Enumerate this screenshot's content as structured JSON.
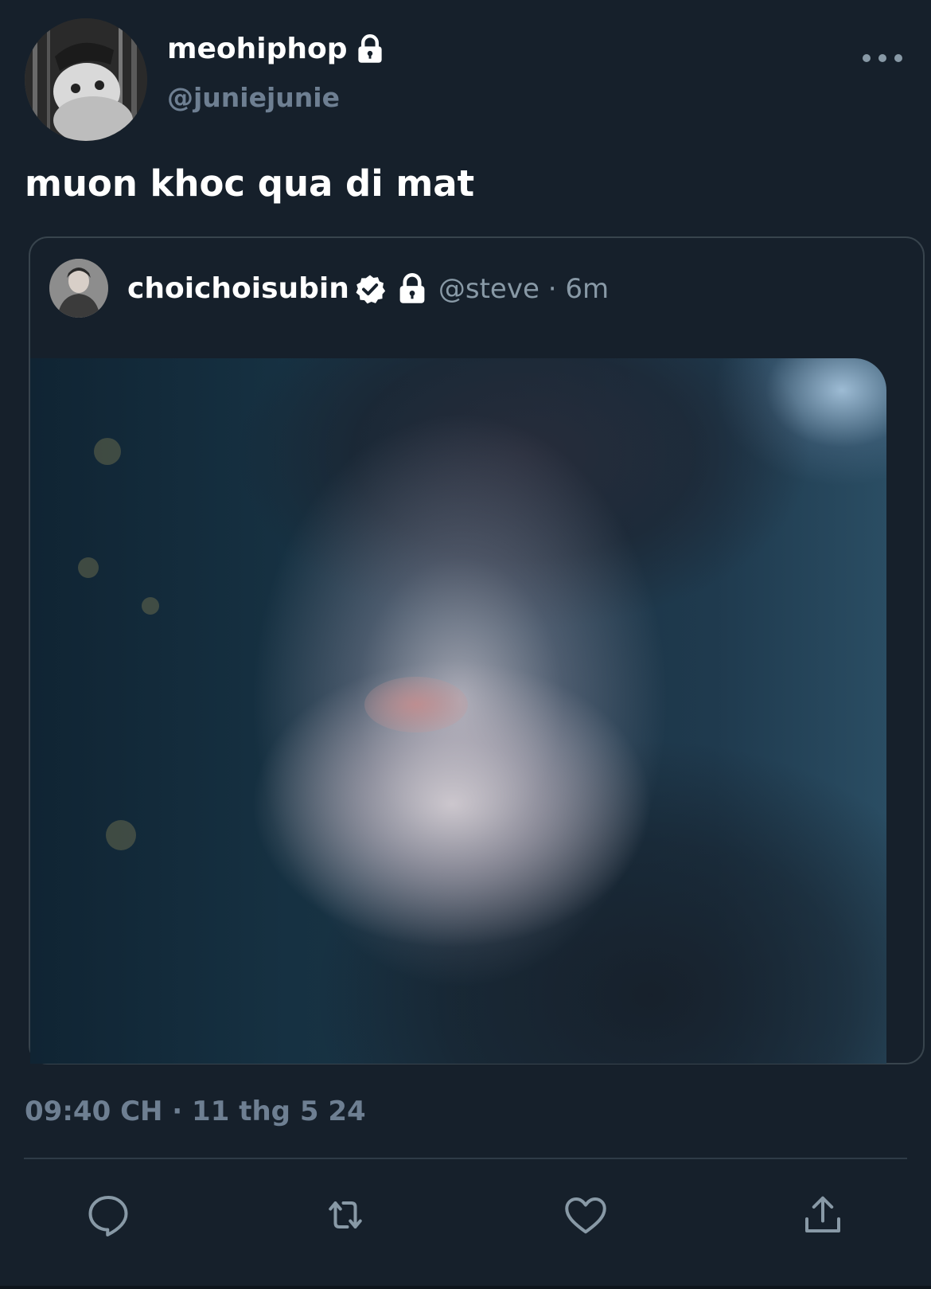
{
  "tweet": {
    "author": {
      "display_name": "meohiphop",
      "handle": "@juniejunie",
      "protected_icon": "lock-icon",
      "avatar": "cat-avatar"
    },
    "text": "muon khoc qua di mat",
    "timestamp": "09:40 CH · 11 thg 5 24"
  },
  "quoted_tweet": {
    "author": {
      "display_name": "choichoisubin",
      "verified_icon": "verified-badge-icon",
      "protected_icon": "lock-icon",
      "avatar": "person-avatar"
    },
    "meta": "@steve · 6m",
    "media": "portrait-photo"
  },
  "actions": {
    "icons": [
      "reply-icon",
      "retweet-icon",
      "like-icon",
      "share-icon"
    ]
  },
  "colors": {
    "background": "#16202b",
    "secondary_text": "#6e7f92",
    "border": "#38444d",
    "icon": "#8899a6"
  }
}
